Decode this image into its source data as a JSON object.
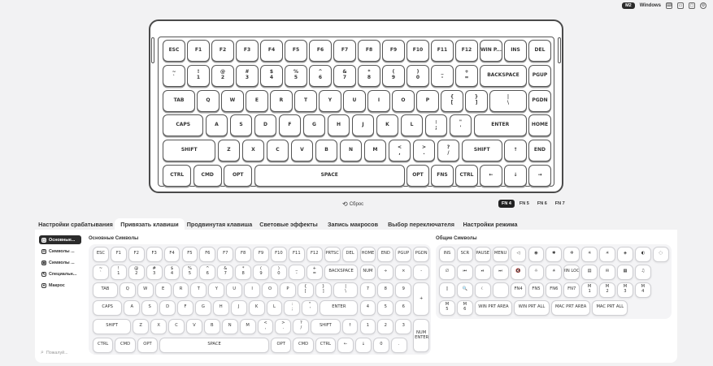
{
  "topbar": {
    "badge": "M2",
    "os": "Windows",
    "icons": [
      "keyboard-icon",
      "monitor-icon",
      "window-icon",
      "settings-icon"
    ]
  },
  "keyboard_main": [
    [
      "ESC",
      "F1",
      "F2",
      "F3",
      "F4",
      "F5",
      "F6",
      "F7",
      "F8",
      "F9",
      "F10",
      "F11",
      "F12",
      "WIN P...",
      "INS",
      "DEL"
    ],
    [
      "~ `",
      "! 1",
      "@ 2",
      "# 3",
      "$ 4",
      "% 5",
      "^ 6",
      "& 7",
      "* 8",
      "( 9",
      ") 0",
      "_ -",
      "+ =",
      "BACKSPACE",
      "PGUP"
    ],
    [
      "TAB",
      "Q",
      "W",
      "E",
      "R",
      "T",
      "Y",
      "U",
      "I",
      "O",
      "P",
      "{ [",
      "} ]",
      "| \\",
      "PGDN"
    ],
    [
      "CAPS",
      "A",
      "S",
      "D",
      "F",
      "G",
      "H",
      "J",
      "K",
      "L",
      ": ;",
      "\" '",
      "ENTER",
      "HOME"
    ],
    [
      "SHIFT",
      "Z",
      "X",
      "C",
      "V",
      "B",
      "N",
      "M",
      "< ,",
      "> .",
      "? /",
      "SHIFT",
      "↑",
      "END"
    ],
    [
      "CTRL",
      "CMD",
      "OPT",
      "SPACE",
      "OPT",
      "FNS",
      "CTRL",
      "←",
      "↓",
      "→"
    ]
  ],
  "reset_label": "Сброс",
  "fn_layers": [
    "FN 4",
    "FN 5",
    "FN 6",
    "FN 7"
  ],
  "tabs": [
    "Настройки срабатывания",
    "Привязать клавиши",
    "Продвинутая клавиша",
    "Световые эффекты",
    "Запись макросов",
    "Выбор переключателя",
    "Настройки режима"
  ],
  "sidebar": {
    "items": [
      "Основные...",
      "Символы ...",
      "Символы ...",
      "Специальн...",
      "Макрос"
    ],
    "search_placeholder": "Пожалуй..."
  },
  "basic_title": "Основные Символы",
  "general_title": "Общие Символы",
  "basic_rows": [
    [
      "ESC",
      "F1",
      "F2",
      "F3",
      "F4",
      "F5",
      "F6",
      "F7",
      "F8",
      "F9",
      "F10",
      "F11",
      "F12",
      "PRTSC",
      "DEL",
      "HOME",
      "END",
      "PGUP",
      "PGDN"
    ],
    [
      "~ `",
      "! 1",
      "@ 2",
      "# 3",
      "$ 4",
      "% 5",
      "^ 6",
      "& 7",
      "* 8",
      "( 9",
      ") 0",
      "_ -",
      "+ =",
      "BACKSPACE",
      "NUM",
      "÷",
      "×",
      "-"
    ],
    [
      "TAB",
      "Q",
      "W",
      "E",
      "R",
      "T",
      "Y",
      "U",
      "I",
      "O",
      "P",
      "{ [",
      "} ]",
      "| \\",
      "7",
      "8",
      "9",
      "+"
    ],
    [
      "CAPS",
      "A",
      "S",
      "D",
      "F",
      "G",
      "H",
      "J",
      "K",
      "L",
      ": ;",
      "\" '",
      "ENTER",
      "4",
      "5",
      "6"
    ],
    [
      "SHIFT",
      "Z",
      "X",
      "C",
      "V",
      "B",
      "N",
      "M",
      "< ,",
      "> .",
      "? /",
      "SHIFT",
      "↑",
      "1",
      "2",
      "3",
      "NUM ENTER"
    ],
    [
      "CTRL",
      "CMD",
      "OPT",
      "SPACE",
      "OPT",
      "CMD",
      "CTRL",
      "←",
      "↓",
      "0",
      "."
    ]
  ],
  "general_rows": [
    [
      "INS",
      "SCR",
      "PAUSE",
      "MENU",
      "◁",
      "◉",
      "✱",
      "✲",
      "✳",
      "☀",
      "◈",
      "◐",
      "◌"
    ],
    [
      "∅",
      "⏮",
      "⏯",
      "⏭",
      "🔇",
      "☼",
      "☀",
      "WIN LOCK",
      "▤",
      "✉",
      "▦",
      "♫"
    ],
    [
      "▯",
      "🔍",
      "☾",
      "",
      "FN4",
      "FN5",
      "FN6",
      "FN7",
      "M 1",
      "M 2",
      "M 3",
      "M 4"
    ],
    [
      "M 5",
      "M 6",
      "WIN PRT AREA",
      "WIN PRT ALL",
      "MAC PRT AREA",
      "MAC PRT ALL"
    ]
  ]
}
